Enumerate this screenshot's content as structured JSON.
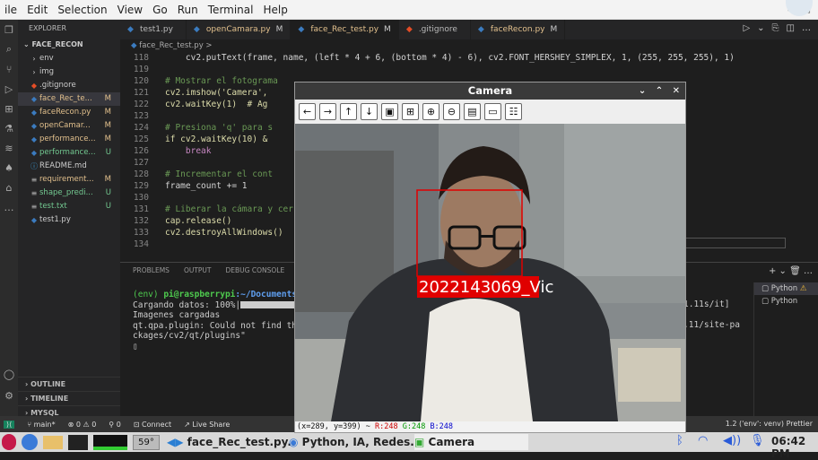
{
  "menubar": {
    "items": [
      "ile",
      "Edit",
      "Selection",
      "View",
      "Go",
      "Run",
      "Terminal",
      "Help"
    ]
  },
  "explorer": {
    "header": "EXPLORER",
    "project": "FACE_RECON",
    "files": [
      {
        "name": "env",
        "icon": "folder-icon",
        "status": "",
        "type": "folder"
      },
      {
        "name": "img",
        "icon": "folder-icon",
        "status": "",
        "type": "folder"
      },
      {
        "name": ".gitignore",
        "icon": "git-icon",
        "status": "",
        "type": "file"
      },
      {
        "name": "face_Rec_te...",
        "icon": "python-icon",
        "status": "M",
        "type": "file"
      },
      {
        "name": "faceRecon.py",
        "icon": "python-icon",
        "status": "M",
        "type": "file"
      },
      {
        "name": "openCamar...",
        "icon": "python-icon",
        "status": "M",
        "type": "file"
      },
      {
        "name": "performance...",
        "icon": "python-icon",
        "status": "M",
        "type": "file"
      },
      {
        "name": "performance...",
        "icon": "python-icon",
        "status": "U",
        "type": "file"
      },
      {
        "name": "README.md",
        "icon": "info-icon",
        "status": "",
        "type": "file"
      },
      {
        "name": "requirement...",
        "icon": "list-icon",
        "status": "M",
        "type": "file"
      },
      {
        "name": "shape_predi...",
        "icon": "list-icon",
        "status": "U",
        "type": "file"
      },
      {
        "name": "test.txt",
        "icon": "list-icon",
        "status": "U",
        "type": "file"
      },
      {
        "name": "test1.py",
        "icon": "python-icon",
        "status": "",
        "type": "file"
      }
    ],
    "outline": "OUTLINE",
    "timeline": "TIMELINE",
    "mysql": "MYSQL"
  },
  "tabs": [
    {
      "label": "test1.py",
      "mod": "",
      "icon": "python-icon",
      "color": "#3b7bbf"
    },
    {
      "label": "openCamara.py",
      "mod": "M",
      "icon": "python-icon",
      "color": "#3b7bbf"
    },
    {
      "label": "face_Rec_test.py",
      "mod": "M",
      "icon": "python-icon",
      "color": "#3b7bbf"
    },
    {
      "label": ".gitignore",
      "mod": "",
      "icon": "git-icon",
      "color": "#e44d26"
    },
    {
      "label": "faceRecon.py",
      "mod": "M",
      "icon": "python-icon",
      "color": "#3b7bbf"
    }
  ],
  "breadcrumb": "face_Rec_test.py >",
  "code": {
    "line_numbers": [
      "118",
      "119",
      "120",
      "121",
      "122",
      "123",
      "124",
      "125",
      "126",
      "127",
      "128",
      "129",
      "130",
      "131",
      "132",
      "133",
      "134"
    ],
    "lines": [
      "    cv2.putText(frame, name, (left * 4 + 6, (bottom * 4) - 6), cv2.FONT_HERSHEY_SIMPLEX, 1, (255, 255, 255), 1)",
      "",
      "# Mostrar el fotograma",
      "cv2.imshow('Camera',",
      "cv2.waitKey(1)  # Ag",
      "",
      "# Presiona 'q' para s",
      "if cv2.waitKey(10) &",
      "    break",
      "",
      "# Incrementar el cont",
      "frame_count += 1",
      "",
      "# Liberar la cámara y cer",
      "cap.release()",
      "cv2.destroyAllWindows()",
      ""
    ]
  },
  "panel": {
    "tabs": [
      "PROBLEMS",
      "OUTPUT",
      "DEBUG CONSOLE"
    ],
    "terminal_prompt_env": "(env) ",
    "terminal_prompt_user": "pi@raspberrypi",
    "terminal_prompt_path": ":~/Documents/",
    "terminal_lines": [
      "Cargando datos: 100%|",
      "Imagenes cargadas",
      "qt.qpa.plugin: Could not find the",
      "ckages/cv2/qt/plugins\"",
      "▯"
    ],
    "terminal_right_1": "1.11s/it]",
    "terminal_right_2": ".11/site-pa",
    "terminal_list": [
      "Python",
      "Python"
    ]
  },
  "status": {
    "branch": "main*",
    "errors": "⊗ 0 ⚠ 0",
    "ports": "0",
    "connect": "Connect",
    "live": "Live Share",
    "right": "1.2 ('env': venv)   Prettier"
  },
  "taskbar": {
    "temp": "59°",
    "task1": "face_Rec_test.py..",
    "task2": "Python, IA, Redes..",
    "task3": "Camera",
    "clock": "06:42 PM"
  },
  "camera": {
    "title": "Camera",
    "toolbar_icons": [
      "arrow-left-icon",
      "arrow-right-icon",
      "arrow-up-icon",
      "arrow-down-icon",
      "image-icon",
      "image-plus-icon",
      "zoom-in-icon",
      "zoom-out-icon",
      "save-icon",
      "window-icon",
      "properties-icon"
    ],
    "face_label": "2022143069_Vic",
    "coords_prefix": "(x=289, y=399) ~ ",
    "r": "R:248",
    "g": "G:248",
    "b": "B:248"
  }
}
